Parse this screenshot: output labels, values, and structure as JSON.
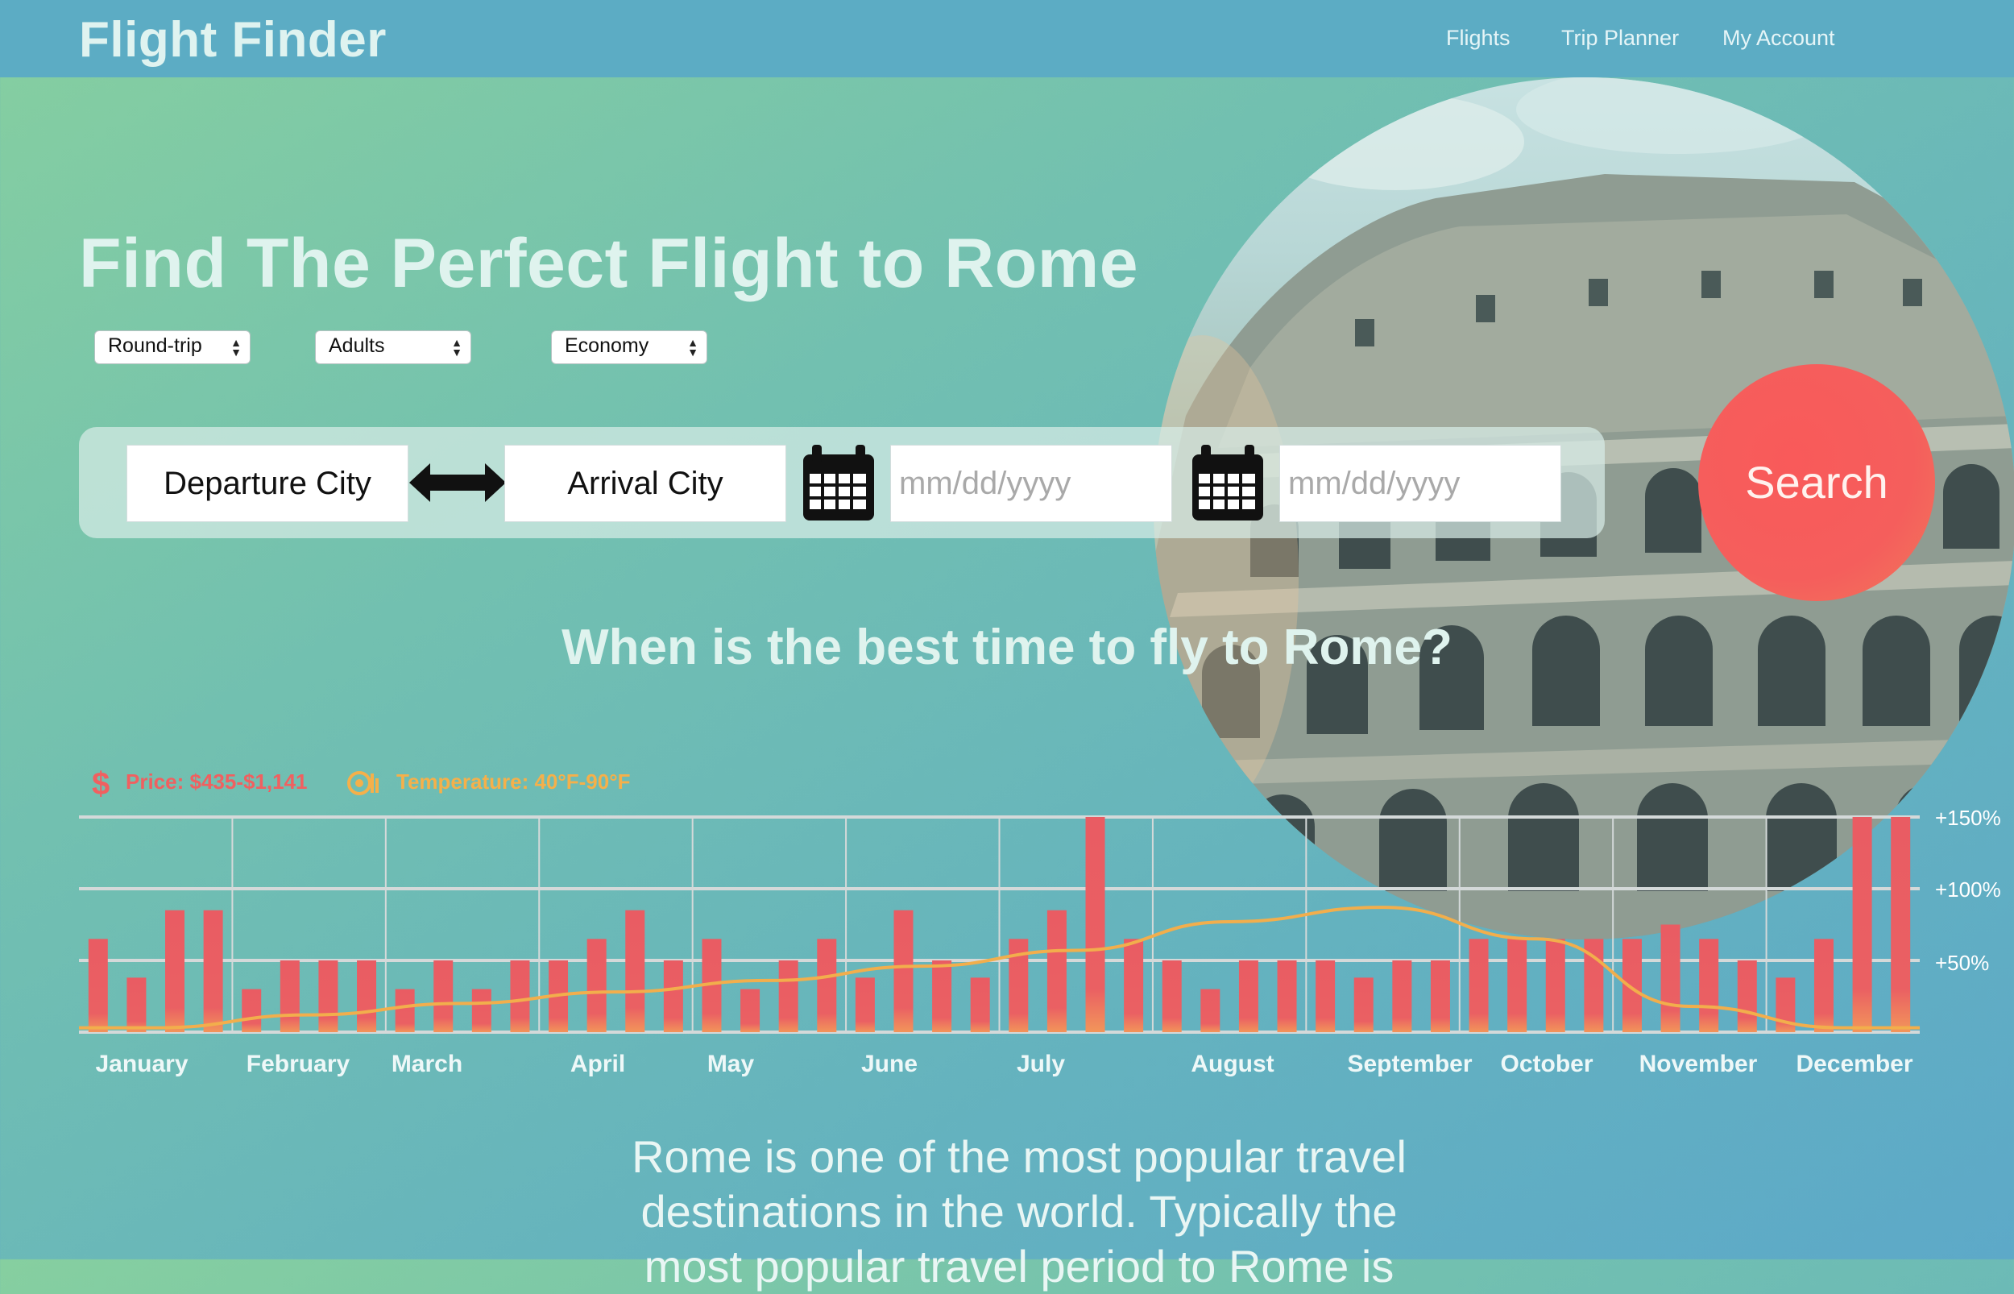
{
  "header": {
    "brand": "Flight Finder",
    "nav": [
      "Flights",
      "Trip Planner",
      "My Account"
    ]
  },
  "hero": {
    "title": "Find The Perfect Flight to Rome"
  },
  "selects": {
    "trip_type": "Round-trip",
    "passengers": "Adults",
    "cabin": "Economy"
  },
  "search": {
    "departure": "Departure City",
    "arrival": "Arrival City",
    "depart_date_placeholder": "mm/dd/yyyy",
    "return_date_placeholder": "mm/dd/yyyy",
    "button_label": "Search",
    "icons": [
      "swap-arrow-icon",
      "calendar-icon",
      "calendar-icon",
      "dollar-icon",
      "thermometer-icon"
    ]
  },
  "best_time": {
    "heading": "When is the best time to fly to Rome?",
    "price_legend": "Price: $435-$1,141",
    "temp_legend": "Temperature: 40°F-90°F"
  },
  "colors": {
    "bar": "#e95c63",
    "bar_bottom": "#f08a5c",
    "temp_line": "#f2ae4c",
    "price_text": "#f06060",
    "temp_text": "#f5b04a",
    "search_button": "#f5585a"
  },
  "chart_data": {
    "type": "bar",
    "title": "",
    "months": [
      "January",
      "February",
      "March",
      "April",
      "May",
      "June",
      "July",
      "August",
      "September",
      "October",
      "November",
      "December"
    ],
    "ytick_labels": [
      "+150%",
      "+100%",
      "+50%"
    ],
    "ylim": [
      0,
      150
    ],
    "series": [
      {
        "name": "Price",
        "values": [
          [
            65,
            38,
            85,
            85
          ],
          [
            30,
            50,
            50,
            50
          ],
          [
            30,
            50,
            30,
            50
          ],
          [
            50,
            65,
            85,
            50
          ],
          [
            65,
            30,
            50,
            65
          ],
          [
            38,
            85,
            50,
            38
          ],
          [
            65,
            85,
            150,
            65
          ],
          [
            50,
            30,
            50,
            50
          ],
          [
            50,
            38,
            50,
            50
          ],
          [
            65,
            65,
            65,
            65
          ],
          [
            65,
            75,
            65,
            50
          ],
          [
            38,
            65,
            150,
            150
          ]
        ]
      },
      {
        "name": "Temperature",
        "type": "line",
        "values": [
          3,
          12,
          20,
          28,
          36,
          46,
          57,
          77,
          87,
          65,
          18,
          3
        ]
      }
    ]
  },
  "description": {
    "line1": "Rome is one of the most popular travel",
    "line2": "destinations in the world.  Typically the",
    "line3": "most popular travel period to Rome is"
  }
}
